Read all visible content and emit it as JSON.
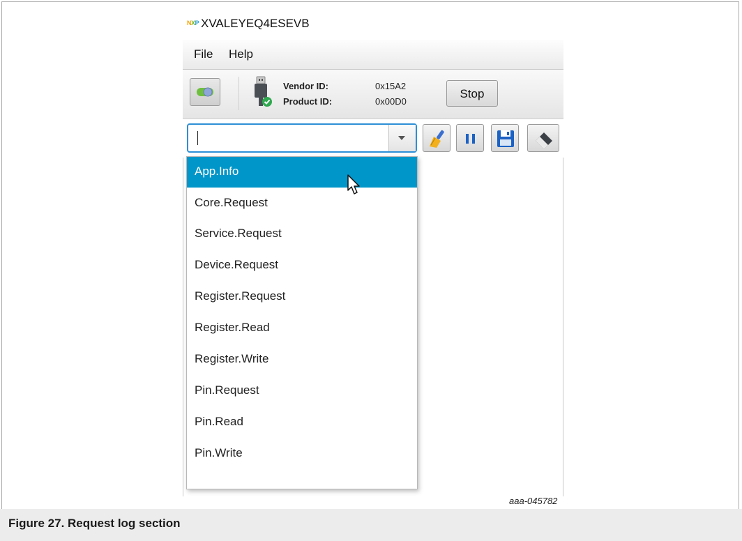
{
  "window": {
    "title": "XVALEYEQ4ESEVB",
    "logo_text": "NXP"
  },
  "menubar": {
    "items": [
      "File",
      "Help"
    ]
  },
  "toolbar": {
    "vendor_label": "Vendor ID:",
    "vendor_value": "0x15A2",
    "product_label": "Product ID:",
    "product_value": "0x00D0",
    "stop_label": "Stop"
  },
  "request_combo": {
    "value": ""
  },
  "dropdown": {
    "selected_index": 0,
    "options": [
      "App.Info",
      "Core.Request",
      "Service.Request",
      "Device.Request",
      "Register.Request",
      "Register.Read",
      "Register.Write",
      "Pin.Request",
      "Pin.Read",
      "Pin.Write"
    ]
  },
  "figure": {
    "id": "aaa-045782",
    "caption": "Figure 27.  Request log section"
  },
  "colors": {
    "selection": "#0096c9",
    "focus_border": "#2d8fd6"
  },
  "icons": [
    "usb-connected-icon",
    "toggle-icon",
    "clear-brush-icon",
    "pause-icon",
    "save-icon",
    "eraser-icon",
    "mouse-pointer-icon"
  ]
}
